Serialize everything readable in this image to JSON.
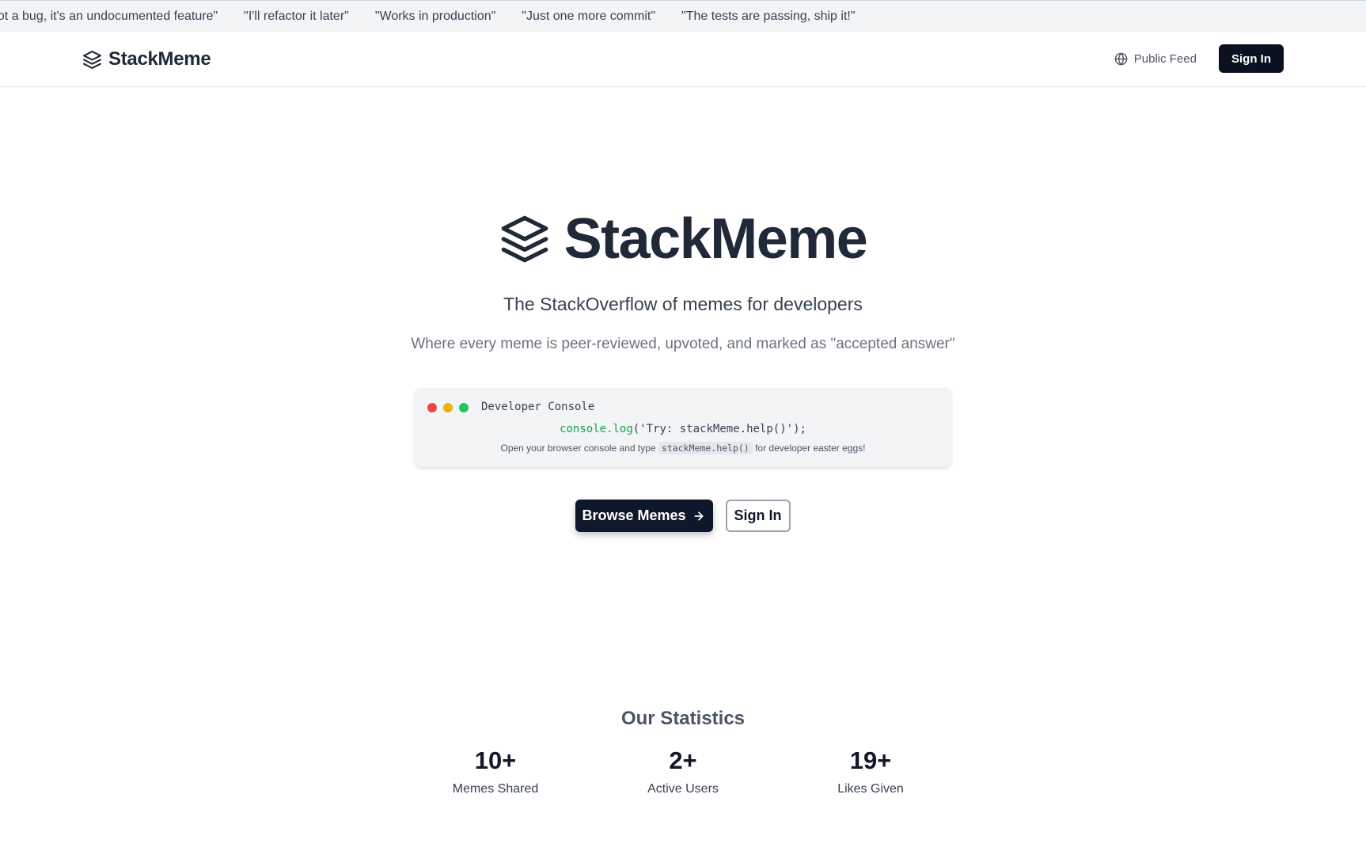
{
  "ticker": [
    "not a bug, it's an undocumented feature\"",
    "\"I'll refactor it later\"",
    "\"Works in production\"",
    "\"Just one more commit\"",
    "\"The tests are passing, ship it!\""
  ],
  "nav": {
    "brand": "StackMeme",
    "public_feed": "Public Feed",
    "sign_in": "Sign In"
  },
  "hero": {
    "title": "StackMeme",
    "tagline": "The StackOverflow of memes for developers",
    "subtagline": "Where every meme is peer-reviewed, upvoted, and marked as \"accepted answer\""
  },
  "console": {
    "title": "Developer Console",
    "code_fn": "console.log",
    "code_rest": "('Try: stackMeme.help()');",
    "hint_before": "Open your browser console and type",
    "hint_code": "stackMeme.help()",
    "hint_after": "for developer easter eggs!"
  },
  "cta": {
    "browse": "Browse Memes",
    "sign_in": "Sign In"
  },
  "stats": {
    "heading": "Our Statistics",
    "items": [
      {
        "value": "10+",
        "label": "Memes Shared"
      },
      {
        "value": "2+",
        "label": "Active Users"
      },
      {
        "value": "19+",
        "label": "Likes Given"
      }
    ]
  },
  "colors": {
    "primary": "#0f172a",
    "dot_red": "#ef4444",
    "dot_yellow": "#eab308",
    "dot_green": "#22c55e",
    "code_green": "#16a34a"
  },
  "icons": {
    "logo": "layers-icon",
    "public_feed": "globe-icon",
    "browse": "arrow-right-icon"
  }
}
